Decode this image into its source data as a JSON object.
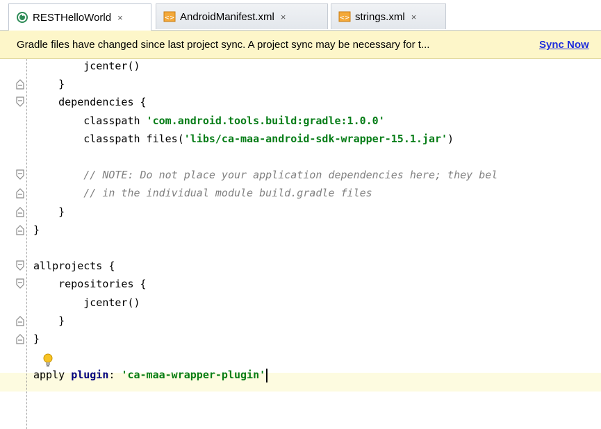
{
  "tabs": [
    {
      "label": "RESTHelloWorld",
      "close": "×",
      "icon": "gradle-sync-icon",
      "active": true
    },
    {
      "label": "AndroidManifest.xml",
      "close": "×",
      "icon": "xml-file-icon",
      "active": false
    },
    {
      "label": "strings.xml",
      "close": "×",
      "icon": "xml-file-icon",
      "active": false
    }
  ],
  "banner": {
    "message": "Gradle files have changed since last project sync. A project sync may be necessary for t...",
    "action": "Sync Now"
  },
  "code": [
    {
      "indent": "        ",
      "parts": [
        {
          "t": "jcenter()",
          "c": "ident"
        }
      ]
    },
    {
      "indent": "    ",
      "parts": [
        {
          "t": "}",
          "c": "ident"
        }
      ]
    },
    {
      "indent": "    ",
      "parts": [
        {
          "t": "dependencies {",
          "c": "ident"
        }
      ]
    },
    {
      "indent": "        ",
      "parts": [
        {
          "t": "classpath ",
          "c": "ident"
        },
        {
          "t": "'com.android.tools.build:gradle:1.0.0'",
          "c": "str"
        }
      ]
    },
    {
      "indent": "        ",
      "parts": [
        {
          "t": "classpath files(",
          "c": "ident"
        },
        {
          "t": "'libs/ca-maa-android-sdk-wrapper-15.1.jar'",
          "c": "str"
        },
        {
          "t": ")",
          "c": "ident"
        }
      ]
    },
    {
      "indent": "",
      "parts": []
    },
    {
      "indent": "        ",
      "parts": [
        {
          "t": "// NOTE: Do not place your application dependencies here; they bel",
          "c": "cmt"
        }
      ]
    },
    {
      "indent": "        ",
      "parts": [
        {
          "t": "// in the individual module build.gradle files",
          "c": "cmt"
        }
      ]
    },
    {
      "indent": "    ",
      "parts": [
        {
          "t": "}",
          "c": "ident"
        }
      ]
    },
    {
      "indent": "",
      "parts": [
        {
          "t": "}",
          "c": "ident"
        }
      ]
    },
    {
      "indent": "",
      "parts": []
    },
    {
      "indent": "",
      "parts": [
        {
          "t": "allprojects {",
          "c": "ident"
        }
      ]
    },
    {
      "indent": "    ",
      "parts": [
        {
          "t": "repositories {",
          "c": "ident"
        }
      ]
    },
    {
      "indent": "        ",
      "parts": [
        {
          "t": "jcenter()",
          "c": "ident"
        }
      ]
    },
    {
      "indent": "    ",
      "parts": [
        {
          "t": "}",
          "c": "ident"
        }
      ]
    },
    {
      "indent": "",
      "parts": [
        {
          "t": "}",
          "c": "ident"
        }
      ]
    },
    {
      "indent": "",
      "parts": []
    },
    {
      "indent": "",
      "parts": [
        {
          "t": "apply ",
          "c": "ident"
        },
        {
          "t": "plugin",
          "c": "kw"
        },
        {
          "t": ": ",
          "c": "ident"
        },
        {
          "t": "'ca-maa-wrapper-plugin'",
          "c": "str"
        }
      ]
    }
  ],
  "folds": [
    {
      "line": 1,
      "type": "end"
    },
    {
      "line": 2,
      "type": "start"
    },
    {
      "line": 6,
      "type": "start"
    },
    {
      "line": 7,
      "type": "end"
    },
    {
      "line": 8,
      "type": "end"
    },
    {
      "line": 9,
      "type": "end"
    },
    {
      "line": 11,
      "type": "start"
    },
    {
      "line": 12,
      "type": "start"
    },
    {
      "line": 14,
      "type": "end"
    },
    {
      "line": 15,
      "type": "end"
    }
  ],
  "colors": {
    "banner_bg": "#fdf6c9",
    "string": "#067d17",
    "keyword": "#000080",
    "comment": "#808080",
    "link": "#1c2cdd"
  }
}
